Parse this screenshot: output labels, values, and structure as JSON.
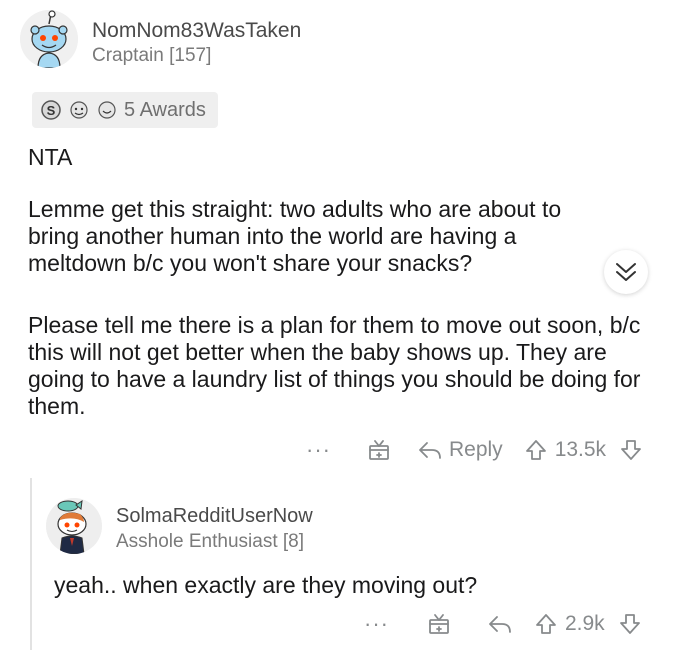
{
  "comment": {
    "username": "NomNom83WasTaken",
    "flair": "Craptain [157]",
    "awards_label": "5 Awards",
    "award_icons": [
      "silver-award-icon",
      "wholesome-award-icon",
      "helpful-award-icon"
    ],
    "paragraphs": [
      "NTA",
      "Lemme get this straight: two adults who are about to bring another human into the world are having a meltdown b/c you won't share your snacks?",
      "Please tell me there is a plan for them to move out soon, b/c this will not get better when the baby shows up. They are going to have a laundry list of things you should be doing for them."
    ],
    "more_label": "···",
    "reply_label": "Reply",
    "score": "13.5k"
  },
  "reply": {
    "username": "SolmaRedditUserNow",
    "flair": "Asshole Enthusiast [8]",
    "body": "yeah.. when exactly are they moving out?",
    "more_label": "···",
    "score": "2.9k"
  },
  "colors": {
    "text": "#1a1a1b",
    "meta": "#878a8c",
    "award_bg": "#efefef",
    "thread_line": "#e2e2e2"
  }
}
